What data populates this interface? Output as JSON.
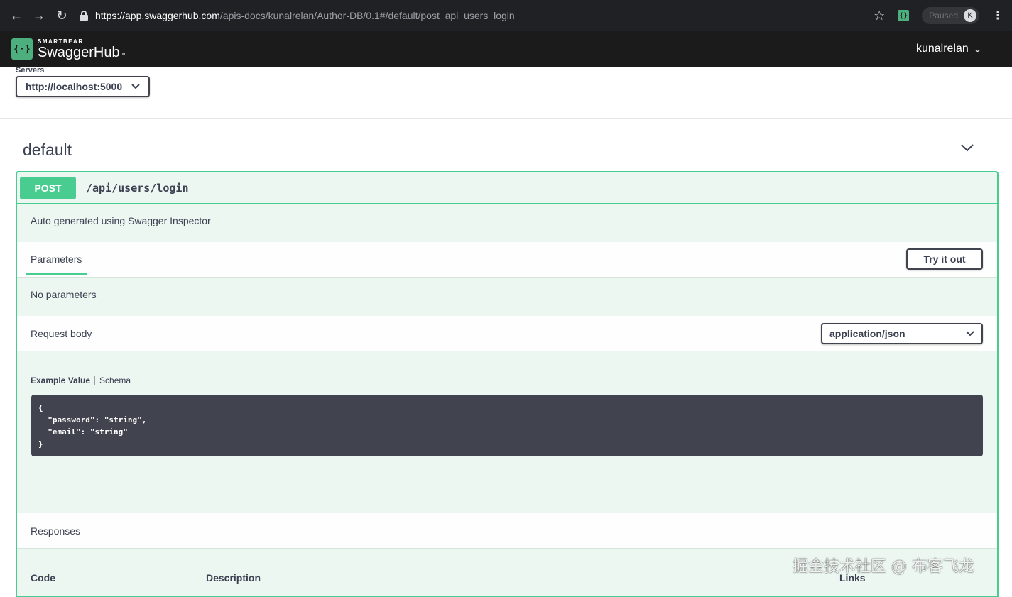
{
  "browser": {
    "url_host": "https://app.swaggerhub.com",
    "url_path": "/apis-docs/kunalrelan/Author-DB/0.1#/default/post_api_users_login",
    "paused_label": "Paused",
    "avatar_letter": "K",
    "icons": [
      "back-icon",
      "forward-icon",
      "reload-icon",
      "lock-icon",
      "star-icon",
      "extension-icon",
      "menu-icon"
    ]
  },
  "header": {
    "brand_small": "SMARTBEAR",
    "brand_name": "SwaggerHub",
    "brand_suffix": "™",
    "username": "kunalrelan",
    "colors": {
      "background": "#1b1b1b",
      "brand": "#4caf7d"
    }
  },
  "servers": {
    "label": "Servers",
    "selected": "http://localhost:5000"
  },
  "section": {
    "title": "default"
  },
  "operation": {
    "method": "POST",
    "path": "/api/users/login",
    "description": "Auto generated using Swagger Inspector",
    "colors": {
      "accent": "#49cc90",
      "background": "#edf7f2"
    },
    "parameters": {
      "tab_label": "Parameters",
      "try_button": "Try it out",
      "empty_text": "No parameters"
    },
    "request_body": {
      "title": "Request body",
      "content_type": "application/json",
      "tab_example": "Example Value",
      "tab_schema": "Schema",
      "example_lines": [
        "{",
        "  \"password\": \"string\",",
        "  \"email\": \"string\"",
        "}"
      ]
    },
    "responses": {
      "title": "Responses",
      "columns": [
        "Code",
        "Description",
        "Links"
      ]
    }
  },
  "watermark": "掘金技术社区 @ 布客飞龙"
}
